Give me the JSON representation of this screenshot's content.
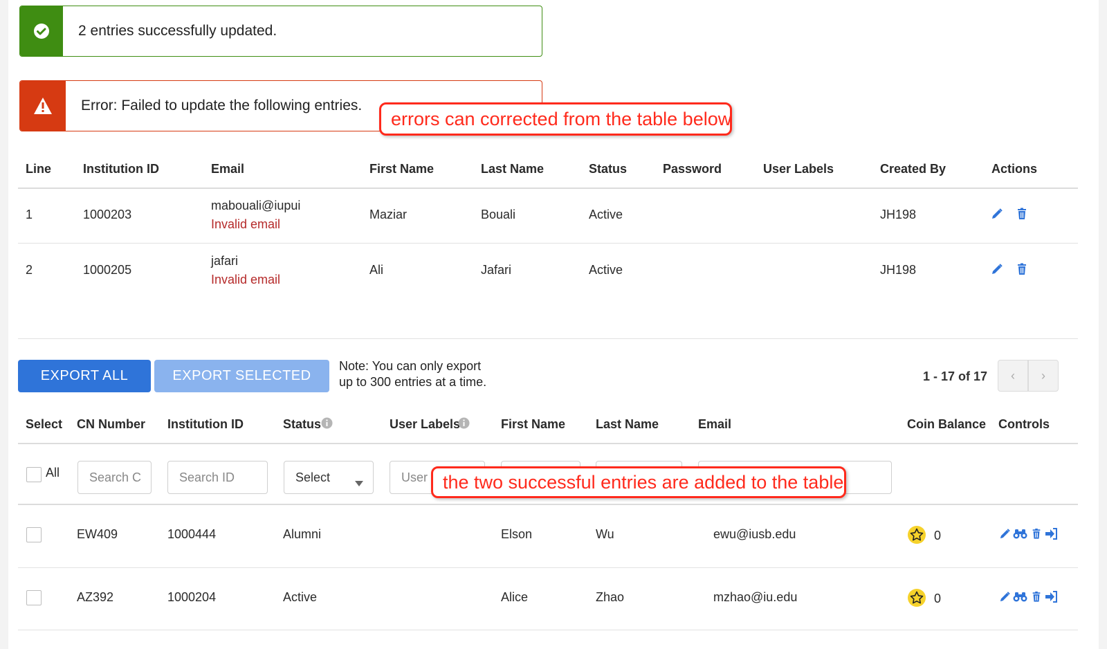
{
  "alerts": {
    "success": "2 entries successfully updated.",
    "error": "Error: Failed to update the following entries."
  },
  "callouts": {
    "errors": "errors can corrected from the table below",
    "success": "the two successful entries are added to the table"
  },
  "error_table": {
    "headers": [
      "Line",
      "Institution ID",
      "Email",
      "First Name",
      "Last Name",
      "Status",
      "Password",
      "User Labels",
      "Created By",
      "Actions"
    ],
    "rows": [
      {
        "line": "1",
        "institution_id": "1000203",
        "email": "mabouali@iupui",
        "email_error": "Invalid email",
        "first_name": "Maziar",
        "last_name": "Bouali",
        "status": "Active",
        "created_by": "JH198"
      },
      {
        "line": "2",
        "institution_id": "1000205",
        "email": "jafari",
        "email_error": "Invalid email",
        "first_name": "Ali",
        "last_name": "Jafari",
        "status": "Active",
        "created_by": "JH198"
      }
    ]
  },
  "toolbar": {
    "export_all": "EXPORT ALL",
    "export_selected": "EXPORT SELECTED",
    "note_line1": "Note: You can only export",
    "note_line2": "up to 300 entries at a time.",
    "pagination": "1 - 17 of 17"
  },
  "user_table": {
    "headers": [
      "Select",
      "CN Number",
      "Institution ID",
      "Status",
      "User Labels",
      "First Name",
      "Last Name",
      "Email",
      "Coin Balance",
      "Controls"
    ],
    "filters": {
      "all_label": "All",
      "cn_placeholder": "Search C",
      "id_placeholder": "Search ID",
      "status_select": "Select",
      "labels_placeholder": "User"
    },
    "rows": [
      {
        "cn": "EW409",
        "institution_id": "1000444",
        "status": "Alumni",
        "first_name": "Elson",
        "last_name": "Wu",
        "email": "ewu@iusb.edu",
        "coins": "0"
      },
      {
        "cn": "AZ392",
        "institution_id": "1000204",
        "status": "Active",
        "first_name": "Alice",
        "last_name": "Zhao",
        "email": "mzhao@iu.edu",
        "coins": "0"
      }
    ]
  },
  "colors": {
    "success": "#3f8d12",
    "error": "#d63a12",
    "primary": "#2f74d9",
    "callout": "#ff2a1c"
  }
}
